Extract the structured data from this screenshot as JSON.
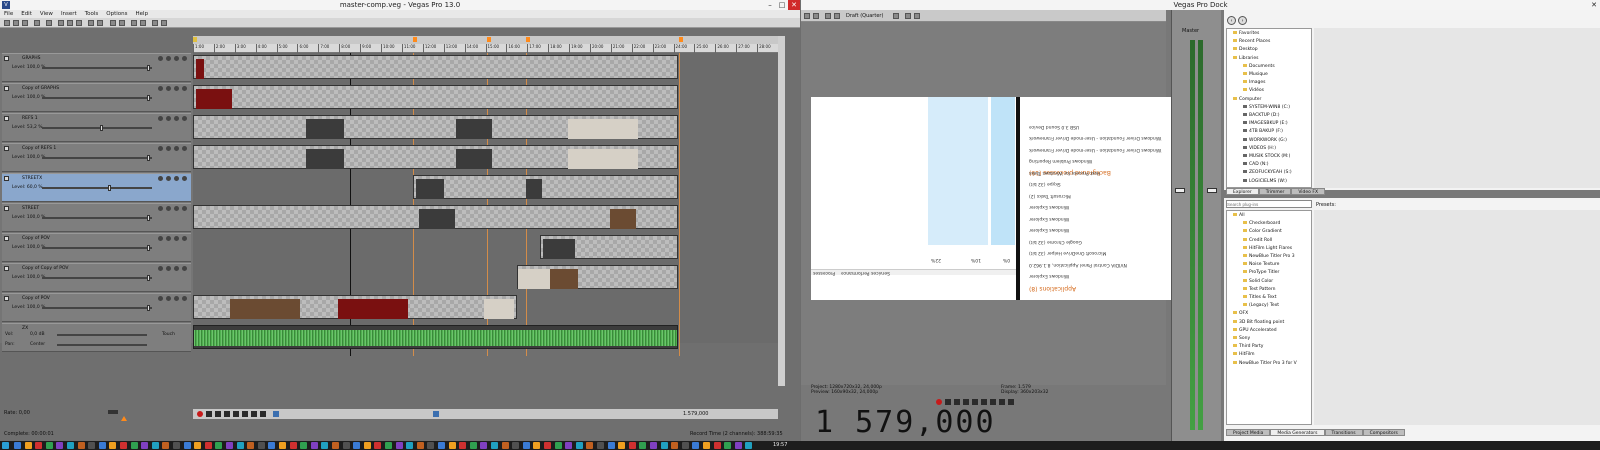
{
  "left_window": {
    "title": "master-comp.veg - Vegas Pro 13.0",
    "menu": [
      "File",
      "Edit",
      "View",
      "Insert",
      "Tools",
      "Options",
      "Help"
    ],
    "ruler_ticks": [
      "1:00",
      "2:00",
      "3:00",
      "4:00",
      "5:00",
      "6:00",
      "7:00",
      "8:00",
      "9:00",
      "10:00",
      "11:00",
      "12:00",
      "13:00",
      "14:00",
      "15:00",
      "16:00",
      "17:00",
      "18:00",
      "19:00",
      "20:00",
      "21:00",
      "22:00",
      "23:00",
      "24:00",
      "25:00",
      "26:00",
      "27:00",
      "28:00"
    ],
    "tracks": [
      {
        "name": "GRAPHS",
        "level": "Level: 100,0 %",
        "knob": 0.95,
        "selected": false
      },
      {
        "name": "Copy of GRAPHS",
        "level": "Level: 100,0 %",
        "knob": 0.95,
        "selected": false
      },
      {
        "name": "REFS 1",
        "level": "Level: 53,2 %",
        "knob": 0.53,
        "selected": false
      },
      {
        "name": "Copy of REFS 1",
        "level": "Level: 100,0 %",
        "knob": 0.95,
        "selected": false
      },
      {
        "name": "STREETX",
        "level": "Level: 60,0 %",
        "knob": 0.6,
        "selected": true
      },
      {
        "name": "STREET",
        "level": "Level: 100,0 %",
        "knob": 0.95,
        "selected": false
      },
      {
        "name": "Copy of POV",
        "level": "Level: 100,0 %",
        "knob": 0.95,
        "selected": false
      },
      {
        "name": "Copy of Copy of POV",
        "level": "Level: 100,0 %",
        "knob": 0.95,
        "selected": false
      },
      {
        "name": "Copy of POV",
        "level": "Level: 100,0 %",
        "knob": 0.95,
        "selected": false
      }
    ],
    "audio_track": {
      "name": "ZX",
      "vol": "Vol:",
      "vol_value": "0,0 dB",
      "pan": "Pan:",
      "pan_value": "Center",
      "touch": "Touch"
    },
    "rate": "Rate: 0,00",
    "complete": "Complete: 00:00:01",
    "record_time": "Record Time (2 channels): 388:59:35",
    "cursor_time": "1.579,000"
  },
  "right_window": {
    "title": "Vegas Pro Dock",
    "preview_mode": "Draft (Quarter)",
    "preview_info": {
      "project": "Project:  1280x720x32, 24,000p",
      "preview": "Preview:  160x90x32, 24,000p",
      "frame": "Frame:     1.579",
      "display": "Display:   360x203x32"
    },
    "timecode": "1 579,000",
    "mirrored": {
      "section_apps": "Applications (8)",
      "section_bg": "Background processes (19)",
      "items": [
        "Windows Explorer",
        "NVIDIA Control Panel Application, 8.1.962.0",
        "Microsoft OneDrive Helper (32 bit)",
        "Google Chrome (32 bit)",
        "Windows Explorer",
        "Windows Explorer",
        "Windows Explorer",
        "Microsoft Tasks (2)",
        "Skype (32 bit)",
        "Host Process for Windows Tasks",
        "Windows Problem Reporting",
        "Windows Driver Foundation - User-mode Driver Framework",
        "Windows Driver Foundation - User-mode Driver Framework",
        "USB 3.0 Sound Device"
      ],
      "tabs": [
        "Processes",
        "Performance",
        "Services"
      ],
      "values": [
        "22%",
        "10%",
        "0%"
      ]
    },
    "mixer_label": "Master",
    "explorer": {
      "tree": [
        "Favorites",
        "Recent Places",
        "Desktop",
        "Libraries",
        "Documents",
        "Musique",
        "Images",
        "Vidéos",
        "Computer",
        "SYSTEM-WIN8 (C:)",
        "BACKTUP (D:)",
        "IMAGESBKUP (E:)",
        "4TB BAKUP (F:)",
        "WORKWORK (G:)",
        "VIDEOS (H:)",
        "MUSIK STOCK (M:)",
        "CAD (N:)",
        "ZEOFUCKYEAH (S:)",
        "LOGICIELMS (W:)"
      ],
      "tabs": [
        "Explorer",
        "Trimmer",
        "Video FX"
      ]
    },
    "media": {
      "search_placeholder": "Search plug-ins",
      "presets_label": "Presets:",
      "tree": [
        "All",
        "Checkerboard",
        "Color Gradient",
        "Credit Roll",
        "HitFilm Light Flares",
        "NewBlue Titler Pro 3",
        "Noise Texture",
        "ProType Titler",
        "Solid Color",
        "Test Pattern",
        "Titles & Text",
        "(Legacy) Text",
        "OFX",
        "3D Bit floating point",
        "GPU Accelerated",
        "Sony",
        "Third Party",
        "HitFilm",
        "NewBlue Titler Pro 3 for V"
      ],
      "tabs": [
        "Project Media",
        "Media Generators",
        "Transitions",
        "Compositors"
      ]
    }
  },
  "taskbar": {
    "time": "19:57"
  },
  "colors": {
    "accent_blue": "#8aa7cc",
    "marker_orange": "#ff8a1a",
    "wave_green": "#4fb04f",
    "close_red": "#d02a2a"
  }
}
